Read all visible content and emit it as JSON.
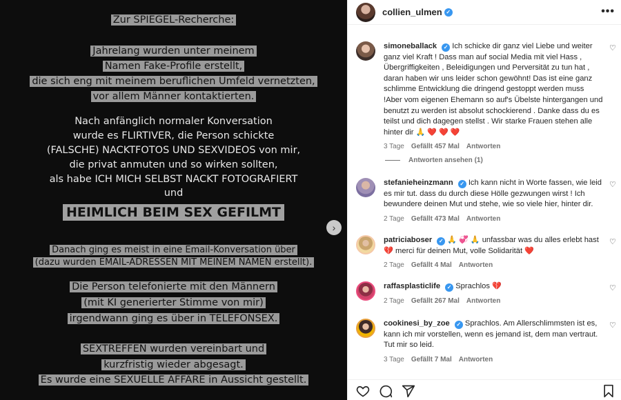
{
  "media": {
    "lines": [
      "Zur SPIEGEL-Recherche:",
      "Jahrelang wurden unter meinem",
      "Namen Fake-Profile erstellt,",
      "die sich eng mit meinem beruflichen Umfeld vernetzten,",
      "vor allem Männer kontaktierten.",
      "Nach anfänglich normaler Konversation",
      "wurde es FLIRTIVER, die Person schickte",
      "(FALSCHE) NACKTFOTOS UND SEXVIDEOS von mir,",
      "die privat anmuten und so wirken sollten,",
      "als habe ICH MICH SELBST NACKT FOTOGRAFIERT",
      "und",
      "HEIMLICH BEIM SEX GEFILMT",
      "Danach ging es meist in eine Email-Konversation über",
      "(dazu wurden EMAIL-ADRESSEN MIT MEINEM NAMEN erstellt).",
      "Die Person telefonierte mit den Männern",
      "(mit KI generierter Stimme von mir)",
      "irgendwann ging es über in TELEFONSEX.",
      "SEXTREFFEN wurden vereinbart und",
      "kurzfristig wieder abgesagt.",
      "Es wurde eine SEXUELLE AFFÄRE in Aussicht gestellt."
    ],
    "next_icon": "›"
  },
  "header": {
    "username": "collien_ulmen",
    "more_icon": "•••"
  },
  "verified_glyph": "✓",
  "heart_outline": "♡",
  "comments": [
    {
      "username": "simoneballack",
      "text": "Ich schicke dir ganz viel Liebe und weiter ganz viel Kraft ! Dass man auf social Media mit viel Hass , Übergriffigkeiten , Beleidigungen und Perversität zu tun hat , daran haben wir uns leider schon gewöhnt! Das ist eine ganz schlimme Entwicklung die dringend gestoppt werden muss !Aber vom eigenen Ehemann so auf's Übelste hintergangen und benutzt zu werden ist absolut schockierend . Danke dass du es teilst und dich dagegen stellst . Wir starke Frauen stehen alle hinter dir",
      "emoji": "🙏 ❤️ ❤️ ❤️",
      "time": "3 Tage",
      "likes": "Gefällt 457 Mal",
      "reply": "Antworten"
    },
    {
      "username": "stefanieheinzmann",
      "text": "Ich kann nicht in Worte fassen, wie leid es mir tut. dass du durch diese Hölle gezwungen wirst ! Ich bewundere deinen Mut und stehe, wie so viele hier, hinter dir.",
      "emoji": "",
      "time": "2 Tage",
      "likes": "Gefällt 473 Mal",
      "reply": "Antworten"
    },
    {
      "username": "patriciaboser",
      "text_prefix": "🙏 💞 🙏",
      "text": "unfassbar was du alles erlebt hast 💔 merci für deinen Mut, volle Solidarität",
      "emoji": "❤️",
      "time": "2 Tage",
      "likes": "Gefällt 4 Mal",
      "reply": "Antworten"
    },
    {
      "username": "raffasplasticlife",
      "text": "Sprachlos",
      "emoji": "💔",
      "time": "2 Tage",
      "likes": "Gefällt 267 Mal",
      "reply": "Antworten"
    },
    {
      "username": "cookinesi_by_zoe",
      "text": "Sprachlos. Am Allerschlimmsten ist es, kann ich mir vorstellen, wenn es jemand ist, dem man vertraut. Tut mir so leid.",
      "emoji": "",
      "time": "3 Tage",
      "likes": "Gefällt 7 Mal",
      "reply": "Antworten"
    }
  ],
  "view_replies": "Antworten ansehen (1)",
  "actions": {
    "like_icon": "heart-icon",
    "comment_icon": "comment-icon",
    "share_icon": "share-icon",
    "save_icon": "bookmark-icon"
  },
  "colors": {
    "verified": "#3897f0",
    "text": "#262626",
    "muted": "#737373"
  }
}
